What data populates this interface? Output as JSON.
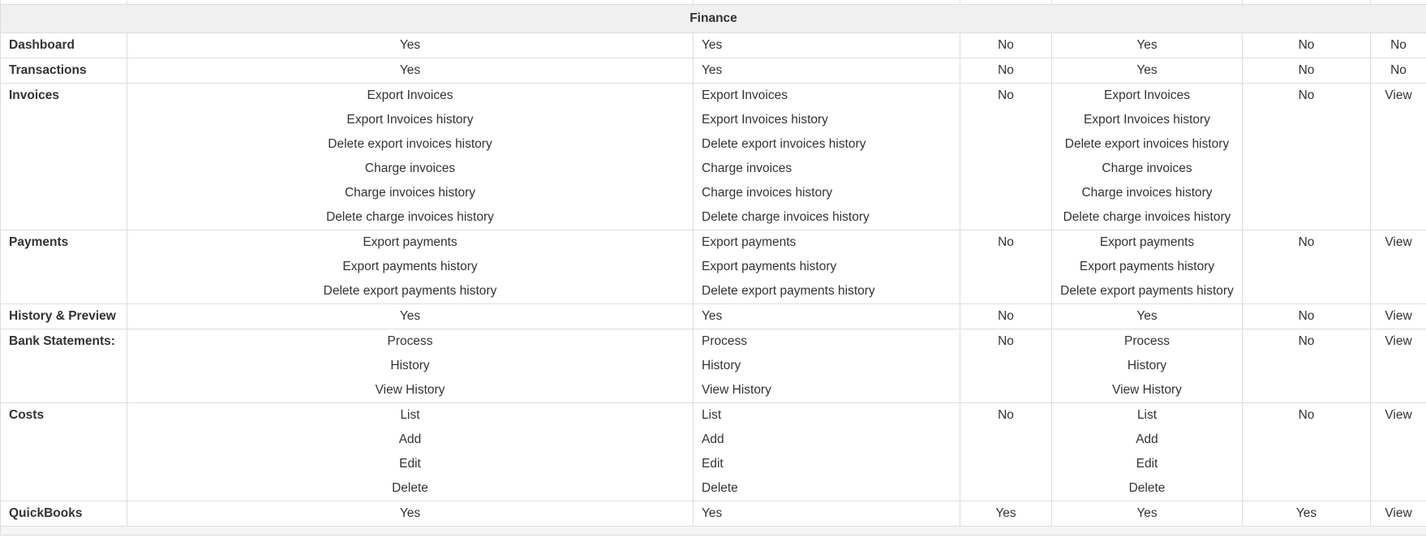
{
  "section_title": "Finance",
  "rows": [
    {
      "label": "Dashboard",
      "c1": [
        "Yes"
      ],
      "c2": [
        "Yes"
      ],
      "c3": [
        "No"
      ],
      "c4": [
        "Yes"
      ],
      "c5": [
        "No"
      ],
      "c6": [
        "No"
      ]
    },
    {
      "label": "Transactions",
      "c1": [
        "Yes"
      ],
      "c2": [
        "Yes"
      ],
      "c3": [
        "No"
      ],
      "c4": [
        "Yes"
      ],
      "c5": [
        "No"
      ],
      "c6": [
        "No"
      ]
    },
    {
      "label": "Invoices",
      "c1": [
        "Export Invoices",
        "Export Invoices history",
        "Delete export invoices history",
        "Charge invoices",
        "Charge invoices history",
        "Delete charge invoices history"
      ],
      "c2": [
        "Export Invoices",
        "Export Invoices history",
        "Delete export invoices history",
        "Charge invoices",
        "Charge invoices history",
        "Delete charge invoices history"
      ],
      "c3": [
        "No"
      ],
      "c4": [
        "Export Invoices",
        "Export Invoices history",
        "Delete export invoices history",
        "Charge invoices",
        "Charge invoices history",
        "Delete charge invoices history"
      ],
      "c5": [
        "No"
      ],
      "c6": [
        "View"
      ]
    },
    {
      "label": "Payments",
      "c1": [
        "Export payments",
        "Export payments history",
        "Delete export payments history"
      ],
      "c2": [
        "Export payments",
        "Export payments history",
        "Delete export payments history"
      ],
      "c3": [
        "No"
      ],
      "c4": [
        "Export payments",
        "Export payments history",
        "Delete export payments history"
      ],
      "c5": [
        "No"
      ],
      "c6": [
        "View"
      ]
    },
    {
      "label": "History & Preview",
      "c1": [
        "Yes"
      ],
      "c2": [
        "Yes"
      ],
      "c3": [
        "No"
      ],
      "c4": [
        "Yes"
      ],
      "c5": [
        "No"
      ],
      "c6": [
        "View"
      ]
    },
    {
      "label": "Bank Statements:",
      "c1": [
        "Process",
        "History",
        "View History"
      ],
      "c2": [
        "Process",
        "History",
        "View History"
      ],
      "c3": [
        "No"
      ],
      "c4": [
        "Process",
        "History",
        "View History"
      ],
      "c5": [
        "No"
      ],
      "c6": [
        "View"
      ]
    },
    {
      "label": "Costs",
      "c1": [
        "List",
        "Add",
        "Edit",
        "Delete"
      ],
      "c2": [
        "List",
        "Add",
        "Edit",
        "Delete"
      ],
      "c3": [
        "No"
      ],
      "c4": [
        "List",
        "Add",
        "Edit",
        "Delete"
      ],
      "c5": [
        "No"
      ],
      "c6": [
        "View"
      ]
    },
    {
      "label": "QuickBooks",
      "c1": [
        "Yes"
      ],
      "c2": [
        "Yes"
      ],
      "c3": [
        "Yes"
      ],
      "c4": [
        "Yes"
      ],
      "c5": [
        "Yes"
      ],
      "c6": [
        "View"
      ]
    }
  ]
}
